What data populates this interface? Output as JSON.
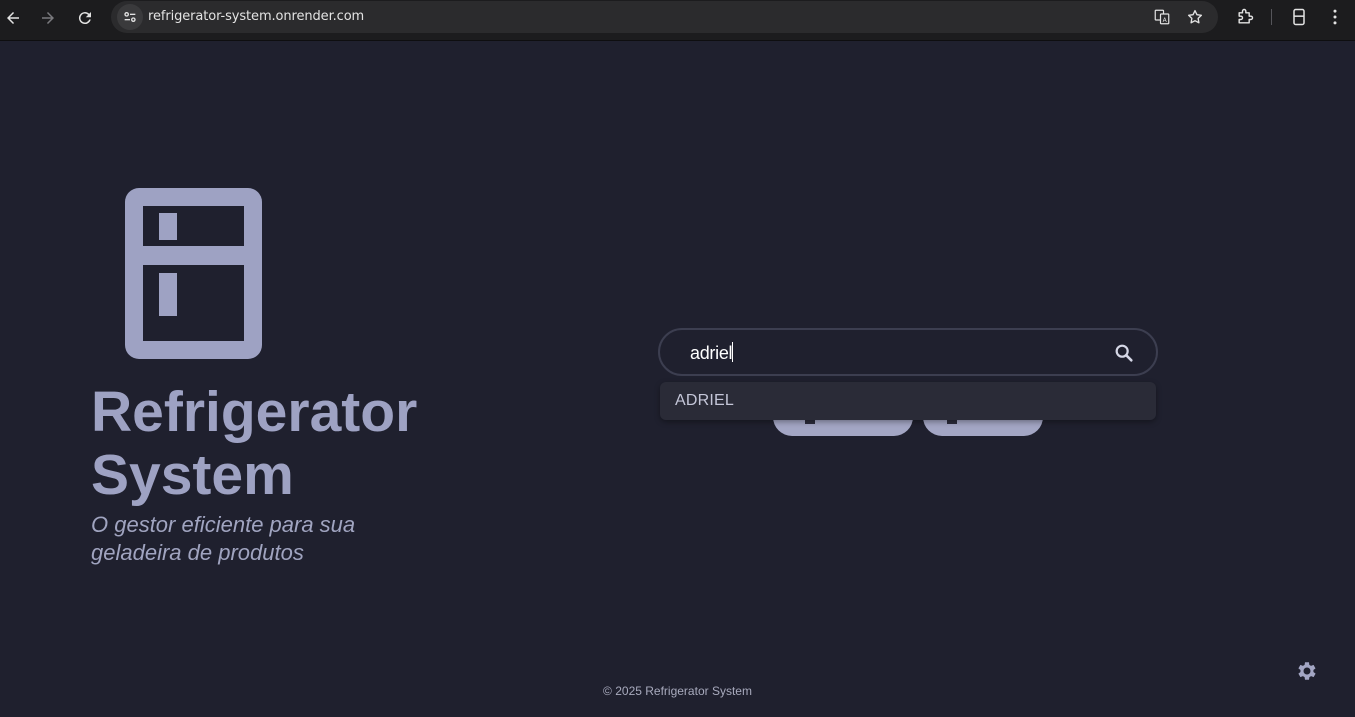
{
  "browser": {
    "url": "refrigerator-system.onrender.com",
    "icons": {
      "back": "arrow-left-icon",
      "forward": "arrow-right-icon",
      "reload": "reload-icon",
      "site_info": "tune-icon",
      "translate": "translate-icon",
      "bookmark": "star-icon",
      "extensions": "puzzle-icon",
      "side_panel": "side-panel-icon",
      "menu": "kebab-menu-icon"
    }
  },
  "hero": {
    "logo_icon": "refrigerator-icon",
    "title": "Refrigerator System",
    "subtitle": "O gestor eficiente para sua geladeira de produtos"
  },
  "search": {
    "value": "adriel",
    "icon": "search-icon",
    "suggestions": [
      {
        "label": "ADRIEL"
      }
    ]
  },
  "footer": {
    "text": "© 2025 Refrigerator System"
  },
  "settings": {
    "icon": "gear-icon"
  },
  "colors": {
    "background": "#1f202e",
    "accent": "#9ea2c3",
    "dropdown": "#2a2b37",
    "chrome": "#1c1c1e"
  }
}
